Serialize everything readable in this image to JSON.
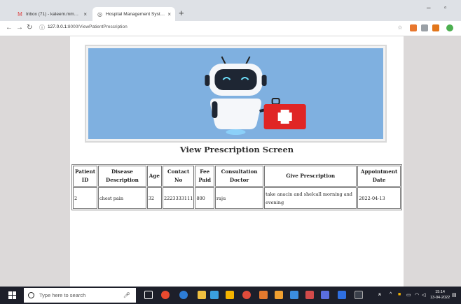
{
  "browser": {
    "tabs": [
      {
        "label": "Inbox (71) - kaleem.mmd@gmai",
        "icon": "gmail-icon"
      },
      {
        "label": "Hospital Management System",
        "icon": "globe-icon"
      }
    ],
    "new_tab": "+",
    "url_host": "127.0.0.1",
    "url_path": ":8000/ViewPatientPrescription"
  },
  "page": {
    "title": "View Prescription Screen",
    "table": {
      "headers": [
        "Patient ID",
        "Disease Description",
        "Age",
        "Contact No",
        "Fee Paid",
        "Consultation Doctor",
        "Give Prescription",
        "Appointment Date"
      ],
      "rows": [
        [
          "2",
          "chest pain",
          "32",
          "2223333111",
          "800",
          "raju",
          "take anacin and shelcall morning and evening",
          "2022-04-13"
        ]
      ]
    }
  },
  "taskbar": {
    "search_placeholder": "Type here to search",
    "time": "15:14",
    "date": "13-04-2022"
  },
  "colors": {
    "hero_bg": "#7fb0e0",
    "page_bg": "#dcd9d9",
    "taskbar": "#1d1f2a"
  }
}
